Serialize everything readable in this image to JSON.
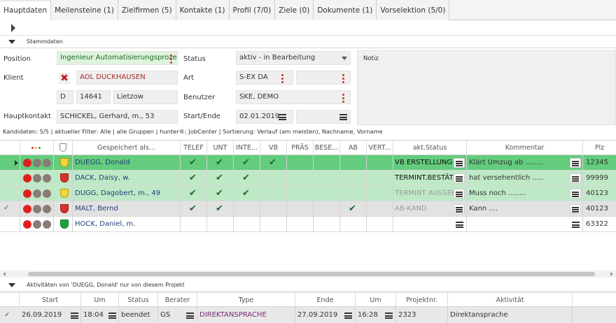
{
  "tabs": [
    {
      "label": "Hauptdaten",
      "active": true
    },
    {
      "label": "Meilensteine (1)"
    },
    {
      "label": "Zielfirmen (5)"
    },
    {
      "label": "Kontakte (1)"
    },
    {
      "label": "Profil (7/0)"
    },
    {
      "label": "Ziele (0)"
    },
    {
      "label": "Dokumente (1)"
    },
    {
      "label": "Vorselektion (5/0)"
    }
  ],
  "stammdaten": {
    "title": "Stammdaten",
    "position_label": "Position",
    "position_value": "Ingenieur Automatisierungsproze",
    "klient_label": "Klient",
    "klient_value": "AOL DUCKHAUSEN",
    "country": "D",
    "zip": "14641",
    "city": "Lietzow",
    "hauptkontakt_label": "Hauptkontakt",
    "hauptkontakt_value": "SCHICKEL, Gerhard, m., 53",
    "status_label": "Status",
    "status_value": "aktiv - in Bearbeitung",
    "art_label": "Art",
    "art_value": "S-EX DA",
    "benutzer_label": "Benutzer",
    "benutzer_value": "SKE, DEMO",
    "startende_label": "Start/Ende",
    "start_value": "02.01.2019",
    "notiz_label": "Notiz"
  },
  "info_line": "Kandidaten: 5/5 | aktueller Filter: Alle | alle Gruppen | hunter®; JobCenter | Sortierung: Verlauf (am meisten), Nachname, Vorname",
  "grid": {
    "headers": {
      "saved_as": "Gespeichert als...",
      "telef": "TELEF",
      "unt": "UNT",
      "inte": "INTE...",
      "vb": "VB",
      "praes": "PRÄS",
      "bese": "BESE...",
      "ab": "AB",
      "vert": "VERT...",
      "status": "akt.Status",
      "kommentar": "Kommentar",
      "plz": "Plz"
    },
    "rows": [
      {
        "name": "DUEGG, Donald",
        "status": "VB ERSTELLUNG",
        "kommentar": "Klärt Umzug ab ........",
        "plz": "12345",
        "bg": "#63cc7d",
        "shield": "yellow",
        "telef": true,
        "unt": true,
        "inte": true,
        "vb": true,
        "ab": false,
        "marker": "play",
        "status_color": "#111"
      },
      {
        "name": "DACK, Daisy, w.",
        "status": "TERMINT.BESTÄT",
        "kommentar": "hat versehentlich .....",
        "plz": "99999",
        "bg": "#bfe9c6",
        "shield": "red",
        "telef": true,
        "unt": true,
        "inte": true,
        "vb": false,
        "ab": false,
        "marker": "",
        "status_color": "#111"
      },
      {
        "name": "DUGG, Dagobert, m., 49",
        "status": "TERMINT AUSSER",
        "kommentar": "Muss noch  ........",
        "plz": "40123",
        "bg": "#bfe9c6",
        "shield": "yellow",
        "telef": true,
        "unt": true,
        "inte": true,
        "vb": false,
        "ab": false,
        "marker": "",
        "status_color": "#9a9a9a"
      },
      {
        "name": "MALT, Bernd",
        "status": "AB-KAND",
        "kommentar": "Kann ....",
        "plz": "40123",
        "bg": "#e2e2e2",
        "shield": "red",
        "telef": true,
        "unt": true,
        "inte": false,
        "vb": false,
        "ab": true,
        "marker": "check",
        "status_color": "#9a9a9a"
      },
      {
        "name": "HOCK, Daniel, m.",
        "status": "",
        "kommentar": "",
        "plz": "63322",
        "bg": "#ffffff",
        "shield": "green",
        "telef": false,
        "unt": false,
        "inte": false,
        "vb": false,
        "ab": false,
        "marker": "",
        "status_color": "#111"
      }
    ]
  },
  "activities": {
    "title": "Aktivitäten von 'DUEGG, Donald' nur von diesem Projekt",
    "headers": {
      "start": "Start",
      "um": "Um",
      "status": "Status",
      "berater": "Berater",
      "type": "Type",
      "ende": "Ende",
      "um2": "Um",
      "projektnr": "Projektnr.",
      "aktivitaet": "Aktivität"
    },
    "row": {
      "start": "26.09.2019",
      "um": "18:04",
      "status": "beendet",
      "berater": "GS",
      "type": "DIREKTANSPRACHE",
      "ende": "27.09.2019",
      "um2": "16:28",
      "projektnr": "2323",
      "aktivitaet": "Direktansprache"
    }
  },
  "colors": {
    "row_selected": "#63cc7d",
    "row_highlight": "#bfe9c6",
    "row_grey": "#e2e2e2",
    "check": "#1d6b28",
    "type_text": "#7a2a7a"
  }
}
